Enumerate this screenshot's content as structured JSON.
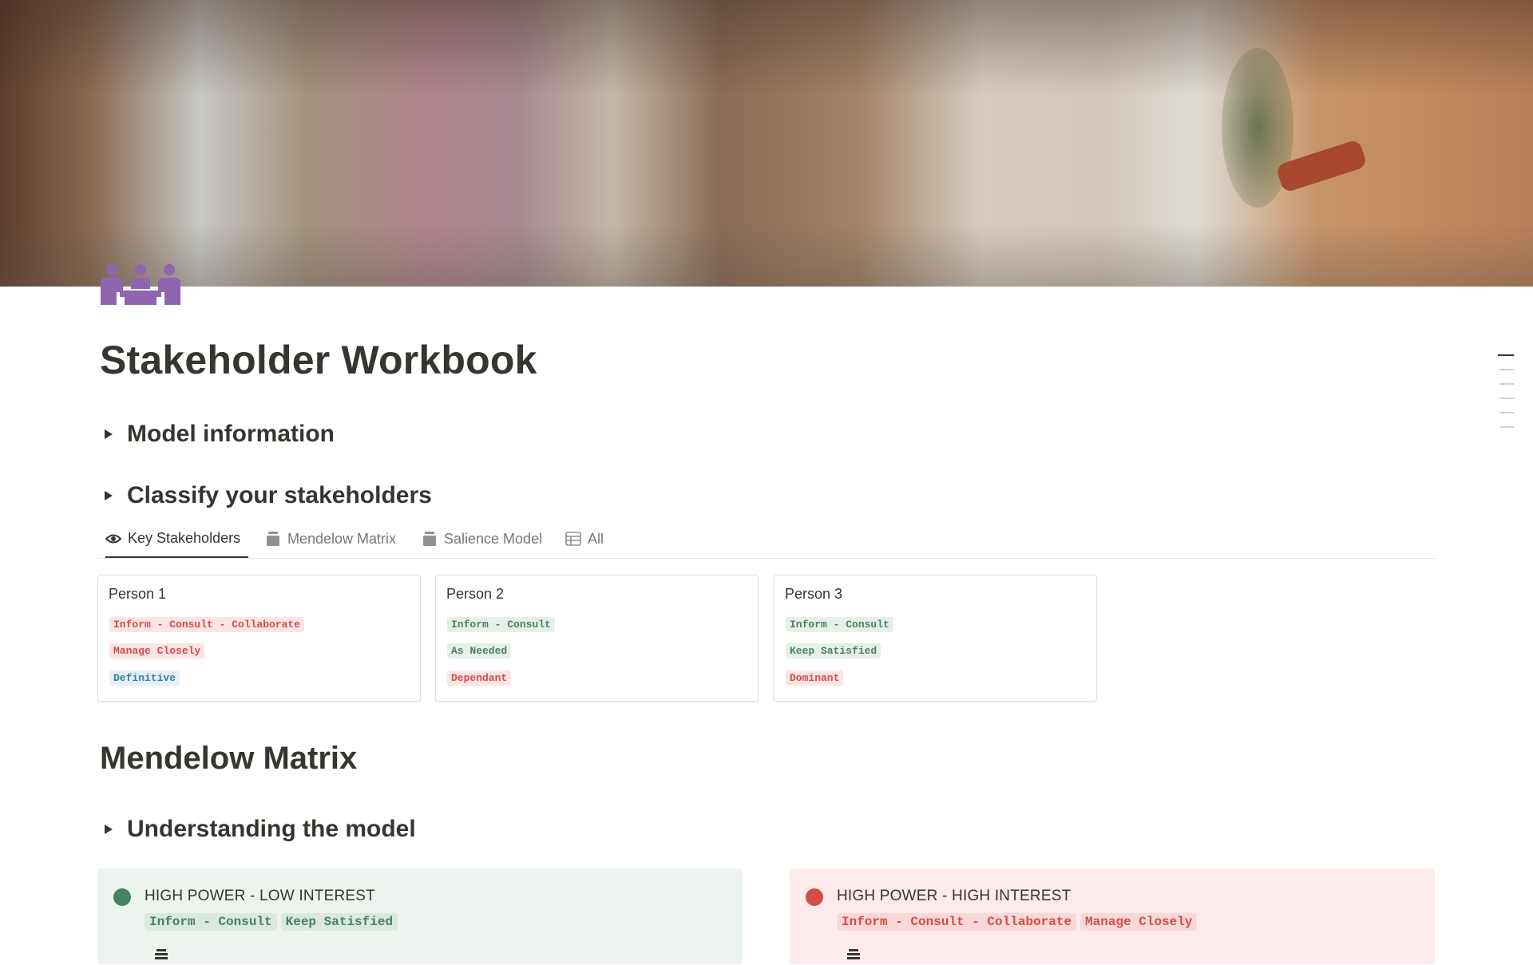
{
  "page": {
    "title": "Stakeholder Workbook",
    "icon": "people-meeting-icon",
    "accent_icon_color": "#9065b0"
  },
  "toggles": [
    {
      "label": "Model information"
    },
    {
      "label": "Classify your stakeholders"
    }
  ],
  "database_view": {
    "tabs": [
      {
        "label": "Key Stakeholders",
        "icon": "eye-icon",
        "active": true
      },
      {
        "label": "Mendelow Matrix",
        "icon": "layers-icon",
        "active": false
      },
      {
        "label": "Salience Model",
        "icon": "layers-icon",
        "active": false
      },
      {
        "label": "All",
        "icon": "table-icon",
        "active": false
      }
    ],
    "cards": [
      {
        "name": "Person 1",
        "tags": [
          {
            "text": "Inform - Consult - Collaborate",
            "color": "red"
          },
          {
            "text": "Manage Closely",
            "color": "red"
          },
          {
            "text": "Definitive",
            "color": "blue"
          }
        ]
      },
      {
        "name": "Person 2",
        "tags": [
          {
            "text": "Inform - Consult",
            "color": "green"
          },
          {
            "text": "As Needed",
            "color": "green"
          },
          {
            "text": "Dependant",
            "color": "red"
          }
        ]
      },
      {
        "name": "Person 3",
        "tags": [
          {
            "text": "Inform - Consult",
            "color": "green"
          },
          {
            "text": "Keep Satisfied",
            "color": "green"
          },
          {
            "text": "Dominant",
            "color": "red"
          }
        ]
      }
    ]
  },
  "mendelow": {
    "heading": "Mendelow Matrix",
    "toggle_label": "Understanding the model",
    "callouts": [
      {
        "title": "HIGH POWER - LOW INTEREST",
        "dot_color": "#448361",
        "tags": [
          "Inform - Consult",
          "Keep Satisfied"
        ]
      },
      {
        "title": "HIGH POWER - HIGH INTEREST",
        "dot_color": "#d44c47",
        "tags": [
          "Inform - Consult - Collaborate",
          "Manage Closely"
        ]
      }
    ]
  }
}
